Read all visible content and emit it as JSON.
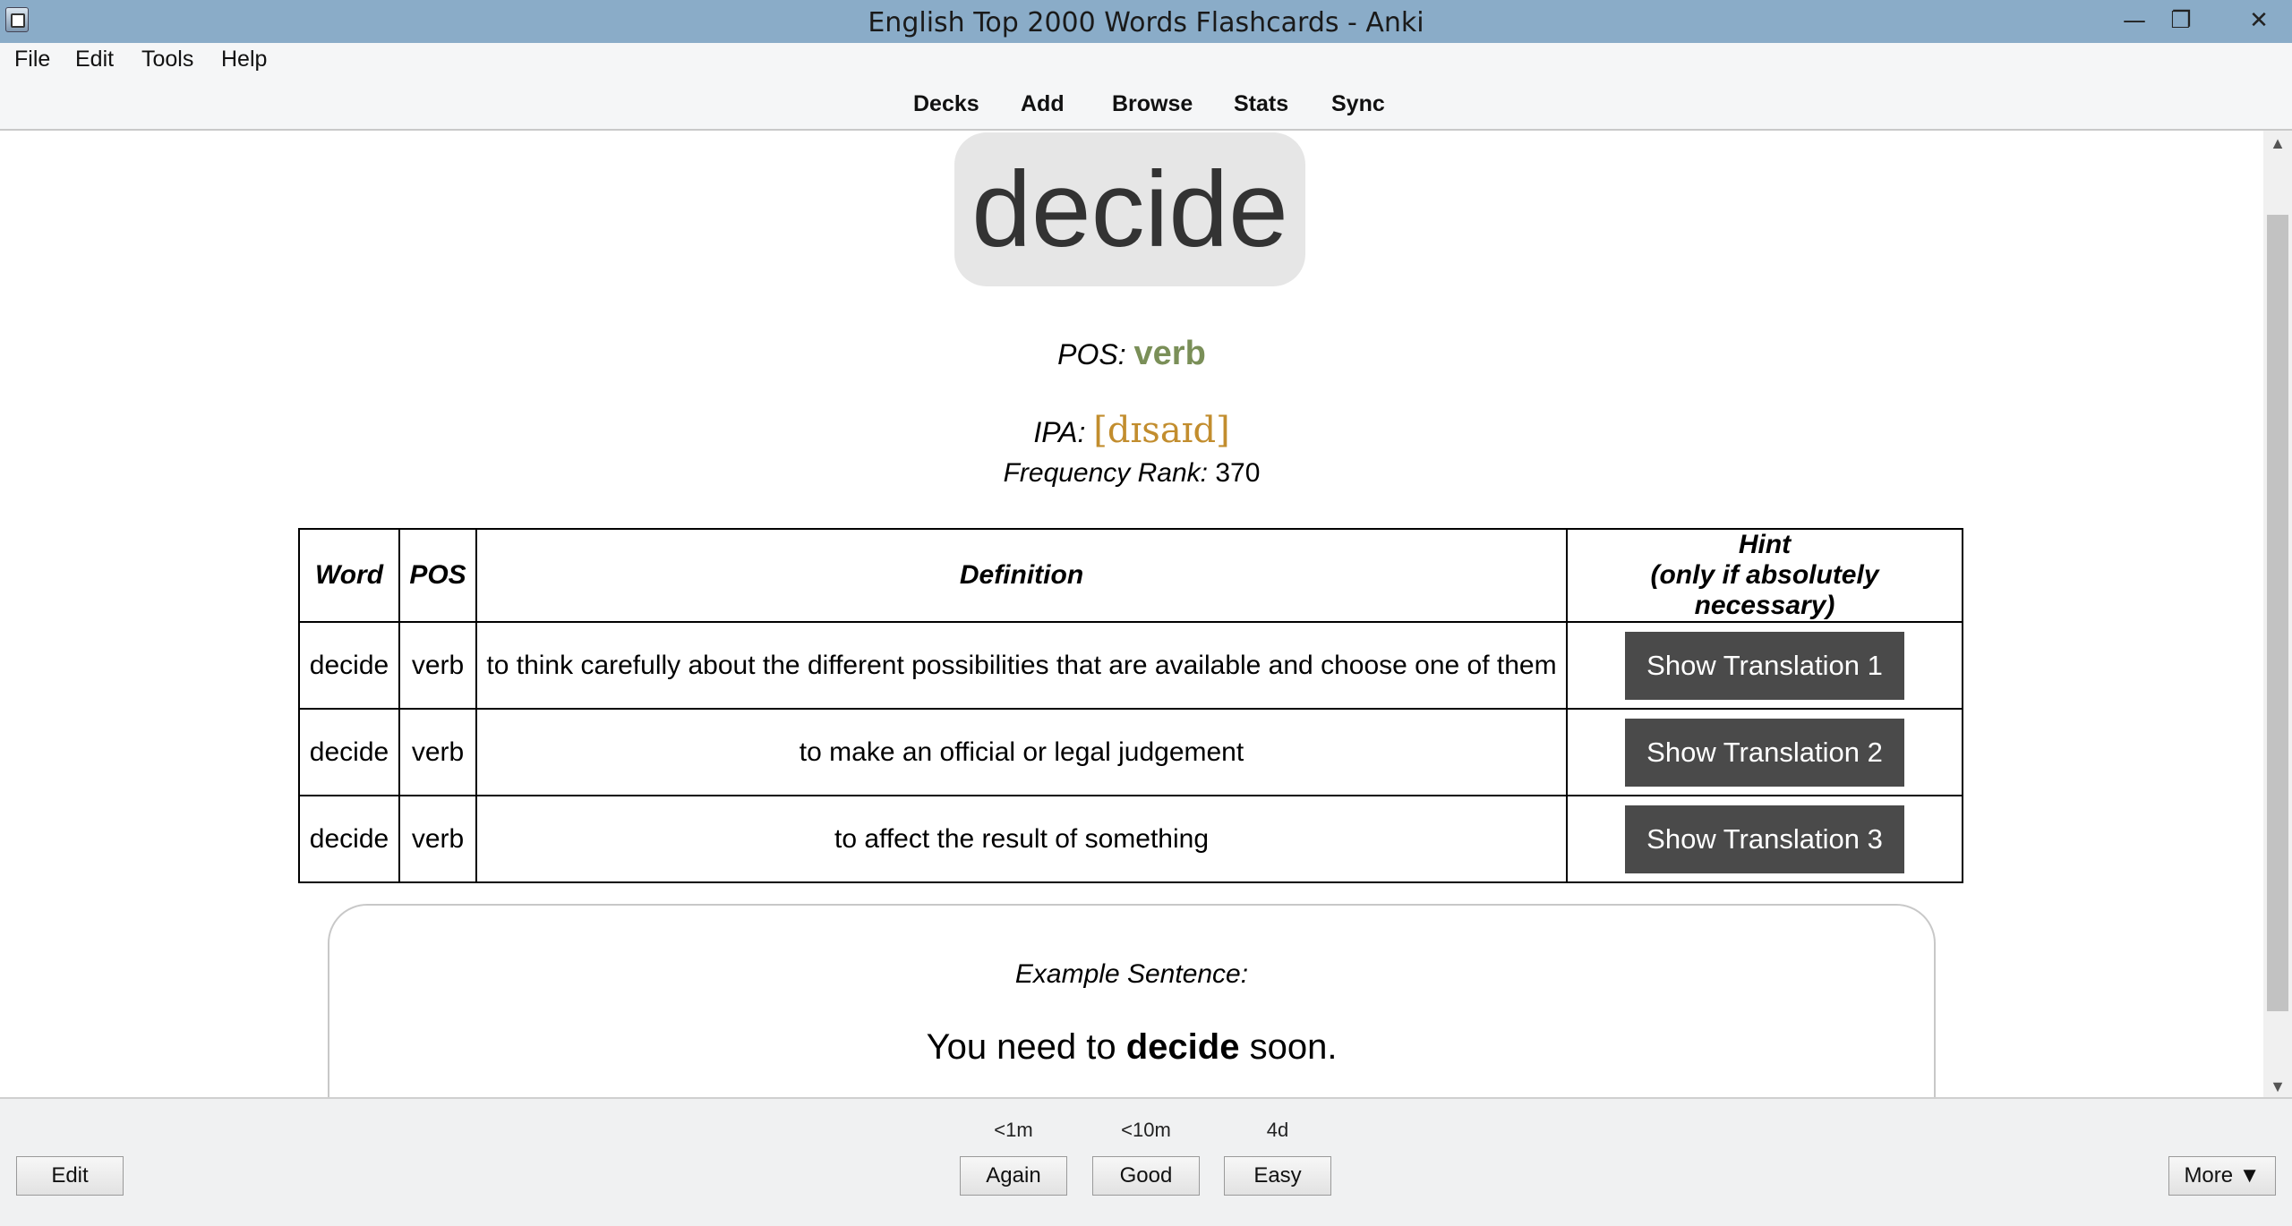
{
  "window": {
    "title": "English Top 2000 Words Flashcards - Anki",
    "minimize": "—",
    "maximize": "❐",
    "close": "✕"
  },
  "menu": {
    "file": "File",
    "edit": "Edit",
    "tools": "Tools",
    "help": "Help"
  },
  "toolbar": {
    "decks": "Decks",
    "add": "Add",
    "browse": "Browse",
    "stats": "Stats",
    "sync": "Sync"
  },
  "card": {
    "word": "decide",
    "pos_label": "POS:",
    "pos_value": "verb",
    "ipa_label": "IPA:",
    "ipa_value": "[dɪsaɪd]",
    "freq_label": "Frequency Rank:",
    "freq_value": "370",
    "table": {
      "headers": [
        "Word",
        "POS",
        "Definition",
        "Hint",
        "(only if absolutely necessary)"
      ],
      "rows": [
        {
          "word": "decide",
          "pos": "verb",
          "definition": "to think carefully about the different possibilities that are available and choose one of them",
          "button": "Show Translation 1"
        },
        {
          "word": "decide",
          "pos": "verb",
          "definition": "to make an official or legal judgement",
          "button": "Show Translation 2"
        },
        {
          "word": "decide",
          "pos": "verb",
          "definition": "to affect the result of something",
          "button": "Show Translation 3"
        }
      ]
    },
    "example": {
      "label": "Example Sentence:",
      "before": "You need to ",
      "bold": "decide",
      "after": " soon."
    }
  },
  "bottom": {
    "edit": "Edit",
    "again": "Again",
    "again_ivl": "<1m",
    "good": "Good",
    "good_ivl": "<10m",
    "easy": "Easy",
    "easy_ivl": "4d",
    "more": "More ▼"
  },
  "scroll": {
    "up": "▲",
    "down": "▼"
  }
}
